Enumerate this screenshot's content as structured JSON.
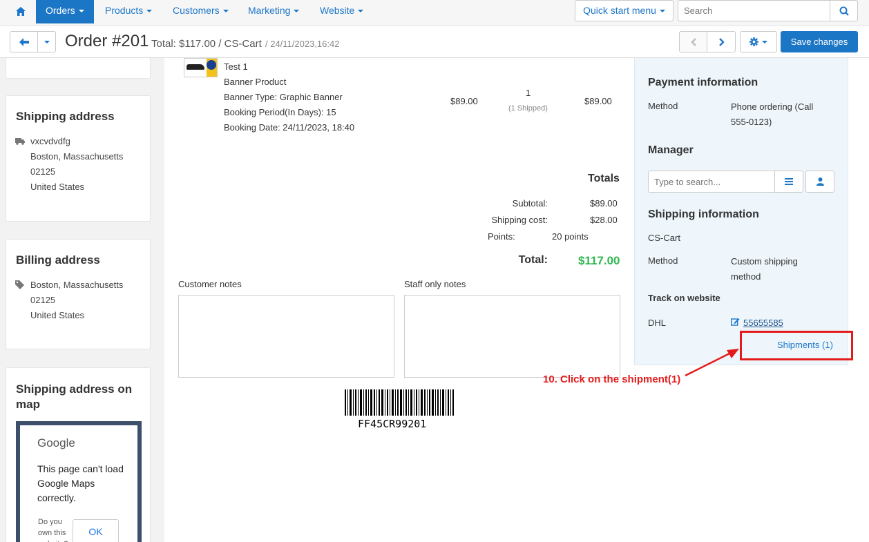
{
  "nav": {
    "orders": "Orders",
    "products": "Products",
    "customers": "Customers",
    "marketing": "Marketing",
    "website": "Website",
    "quick_start": "Quick start menu",
    "search_placeholder": "Search"
  },
  "header": {
    "title": "Order #201",
    "total": "Total: $117.00 / CS-Cart",
    "date": "/ 24/11/2023,16:42",
    "save": "Save changes"
  },
  "product": {
    "name": "Test 1",
    "type": "Banner Product",
    "banner_type": "Banner Type: Graphic Banner",
    "period": "Booking Period(In Days): 15",
    "booking_date": "Booking Date: 24/11/2023, 18:40",
    "price": "$89.00",
    "qty": "1",
    "shipped": "(1 Shipped)",
    "subtotal": "$89.00"
  },
  "totals": {
    "title": "Totals",
    "subtotal_label": "Subtotal:",
    "subtotal_value": "$89.00",
    "shipping_label": "Shipping cost:",
    "shipping_value": "$28.00",
    "points_label": "Points:",
    "points_value": "20 points",
    "total_label": "Total:",
    "total_value": "$117.00"
  },
  "notes": {
    "customer": "Customer notes",
    "staff": "Staff only notes"
  },
  "barcode": "FF45CR99201",
  "shipping_address": {
    "title": "Shipping address",
    "name": "vxcvdvdfg",
    "city": "Boston, Massachusetts",
    "zip": "02125",
    "country": "United States"
  },
  "billing_address": {
    "title": "Billing address",
    "city": "Boston, Massachusetts",
    "zip": "02125",
    "country": "United States"
  },
  "map": {
    "title": "Shipping address on map",
    "google": "Google",
    "message": "This page can't load Google Maps correctly.",
    "own": "Do you own this website?",
    "ok": "OK"
  },
  "payment": {
    "title": "Payment information",
    "method_label": "Method",
    "method_value": "Phone ordering (Call 555-0123)"
  },
  "manager": {
    "title": "Manager",
    "placeholder": "Type to search..."
  },
  "shipping_info": {
    "title": "Shipping information",
    "carrier_name": "CS-Cart",
    "method_label": "Method",
    "method_value": "Custom shipping method",
    "track_title": "Track on website",
    "carrier": "DHL",
    "tracking": "55655585",
    "shipments": "Shipments (1)"
  },
  "annotation": "10. Click on the shipment(1)",
  "colors": {
    "primary": "#1b76c5",
    "green": "#2fb84f",
    "annotation_red": "#e41b1b"
  }
}
